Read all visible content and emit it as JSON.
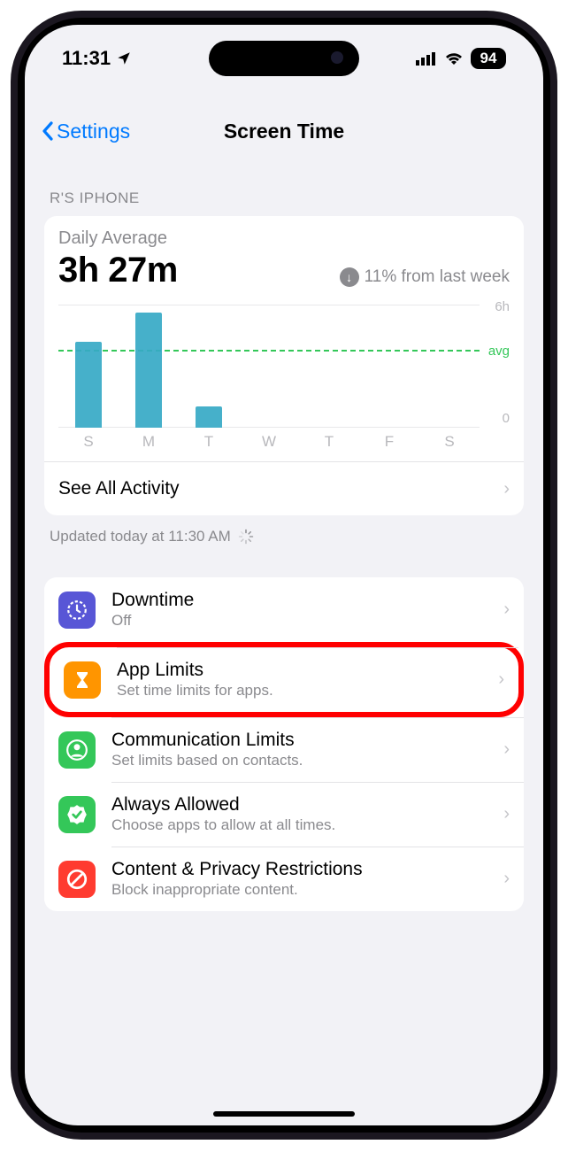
{
  "status_bar": {
    "time": "11:31",
    "battery": "94"
  },
  "nav": {
    "back_label": "Settings",
    "title": "Screen Time"
  },
  "section_header": "R'S IPHONE",
  "daily_average": {
    "label": "Daily Average",
    "value": "3h 27m",
    "trend_text": "11% from last week",
    "trend_direction": "down"
  },
  "chart_data": {
    "type": "bar",
    "categories": [
      "S",
      "M",
      "T",
      "W",
      "T",
      "F",
      "S"
    ],
    "values": [
      4.0,
      5.4,
      1.0,
      0,
      0,
      0,
      0
    ],
    "avg": 3.45,
    "ylim": [
      0,
      6
    ],
    "ylabel_top": "6h",
    "ylabel_zero": "0",
    "avg_label": "avg"
  },
  "see_all_label": "See All Activity",
  "updated_text": "Updated today at 11:30 AM",
  "menu": {
    "items": [
      {
        "title": "Downtime",
        "sub": "Off",
        "color": "#5856d6",
        "icon": "clock"
      },
      {
        "title": "App Limits",
        "sub": "Set time limits for apps.",
        "color": "#ff9500",
        "icon": "hourglass",
        "highlight": true
      },
      {
        "title": "Communication Limits",
        "sub": "Set limits based on contacts.",
        "color": "#34c759",
        "icon": "person"
      },
      {
        "title": "Always Allowed",
        "sub": "Choose apps to allow at all times.",
        "color": "#34c759",
        "icon": "check"
      },
      {
        "title": "Content & Privacy Restrictions",
        "sub": "Block inappropriate content.",
        "color": "#ff3b30",
        "icon": "nosign"
      }
    ]
  }
}
